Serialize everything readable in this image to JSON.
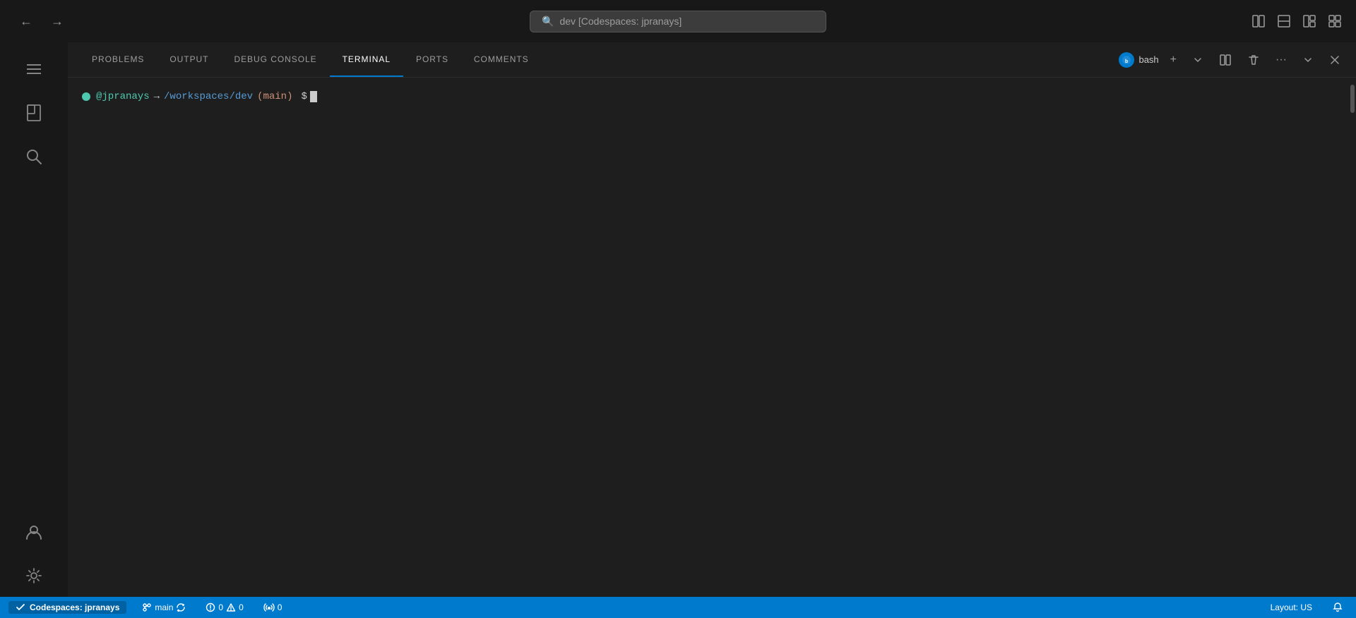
{
  "titlebar": {
    "back_label": "←",
    "forward_label": "→",
    "search_icon": "🔍",
    "search_text": "dev [Codespaces: jpranays]",
    "layout_icon_1": "⬜",
    "layout_icon_2": "⬜",
    "layout_icon_3": "⬜",
    "layout_icon_4": "⬜"
  },
  "activity_bar": {
    "items": [
      {
        "name": "menu-icon",
        "icon": "☰"
      },
      {
        "name": "copy-icon",
        "icon": "⧉"
      },
      {
        "name": "search-icon",
        "icon": "⌕"
      },
      {
        "name": "more-icon",
        "icon": "···"
      },
      {
        "name": "account-icon",
        "icon": "⊙"
      },
      {
        "name": "settings-icon",
        "icon": "⚙"
      }
    ]
  },
  "panel": {
    "tabs": [
      {
        "label": "PROBLEMS",
        "active": false
      },
      {
        "label": "OUTPUT",
        "active": false
      },
      {
        "label": "DEBUG CONSOLE",
        "active": false
      },
      {
        "label": "TERMINAL",
        "active": true
      },
      {
        "label": "PORTS",
        "active": false
      },
      {
        "label": "COMMENTS",
        "active": false
      }
    ],
    "shell_name": "bash",
    "add_label": "+",
    "split_label": "⧉",
    "delete_label": "🗑",
    "more_label": "···",
    "chevron_down_label": "⌄",
    "close_label": "✕"
  },
  "terminal": {
    "dot_color": "#4ec9b0",
    "user": "@jpranays",
    "arrow": "→",
    "path": "/workspaces/dev",
    "branch": "(main)",
    "dollar": "$"
  },
  "statusbar": {
    "codespaces_icon": "⊗",
    "codespaces_label": "Codespaces: jpranays",
    "branch_icon": "⎇",
    "branch_name": "main",
    "sync_icon": "↻",
    "error_icon": "⊗",
    "error_count": "0",
    "warning_icon": "△",
    "warning_count": "0",
    "broadcast_icon": "((·))",
    "broadcast_count": "0",
    "layout_label": "Layout: US",
    "bell_icon": "🔔"
  }
}
